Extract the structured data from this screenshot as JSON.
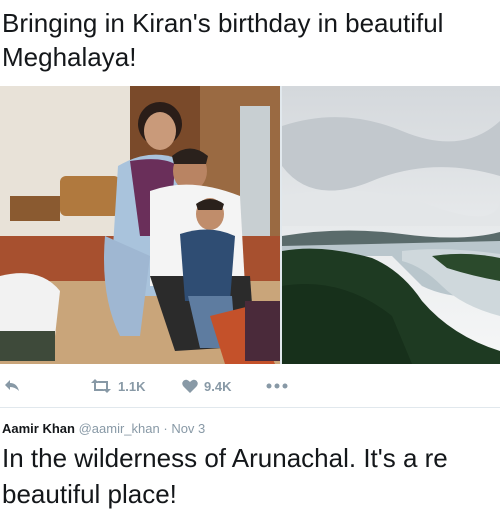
{
  "tweet1": {
    "text_line1": "Bringing in Kiran's birthday in beautiful",
    "text_line2": "Meghalaya!",
    "actions": {
      "reply_icon": "reply-icon",
      "retweet_icon": "retweet-icon",
      "retweet_count": "1.1K",
      "like_icon": "heart-icon",
      "like_count": "9.4K",
      "more_icon": "more-icon"
    }
  },
  "tweet2": {
    "author_name": "Aamir Khan",
    "author_handle": "@aamir_khan",
    "separator": "·",
    "date": "Nov 3",
    "text_line1": "In the wilderness of Arunachal. It's a re",
    "text_line2": "beautiful place!"
  },
  "colors": {
    "text": "#14171a",
    "muted": "#8899a6",
    "divider": "#e1e8ed"
  }
}
